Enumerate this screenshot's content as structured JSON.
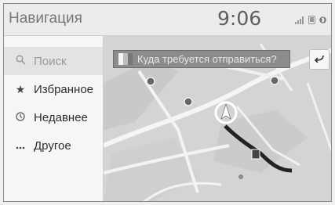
{
  "header": {
    "title": "Навигация",
    "clock": "9:06",
    "status_icons": [
      "signal-icon",
      "phone-icon",
      "bluetooth-icon"
    ]
  },
  "sidebar": {
    "items": [
      {
        "icon": "search-icon",
        "label": "Поиск"
      },
      {
        "icon": "star-icon",
        "label": "Избранное"
      },
      {
        "icon": "clock-icon",
        "label": "Недавнее"
      },
      {
        "icon": "more-icon",
        "label": "Другое"
      }
    ]
  },
  "destination": {
    "placeholder": "Куда требуется отправиться?"
  },
  "map": {
    "labels": []
  }
}
